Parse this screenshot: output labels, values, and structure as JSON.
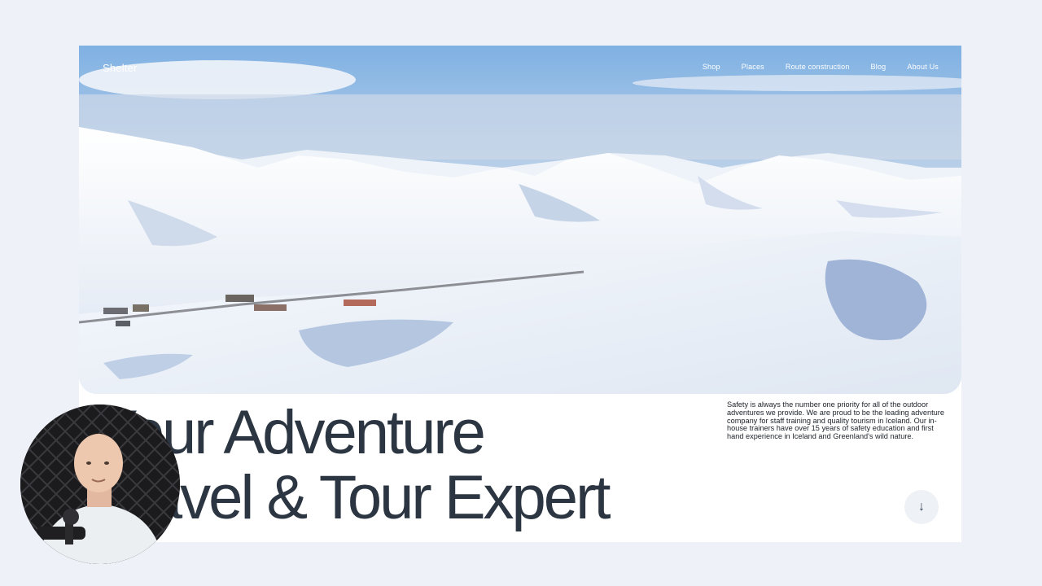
{
  "site": {
    "logo": "Shelter",
    "nav": [
      "Shop",
      "Places",
      "Route construction",
      "Blog",
      "About Us"
    ]
  },
  "hero": {
    "headline_line1": "Your Adventure",
    "headline_line2": "Travel & Tour Expert",
    "description": "Safety is always the number one priority for all of the outdoor adventures we provide. We are proud to be the leading adventure company for staff training and quality tourism in Iceland. Our in-house trainers have over 15 years of safety education and first hand experience in Iceland and Greenland's wild nature.",
    "scroll_icon": "arrow-down-icon"
  },
  "overlay": {
    "webcam_icon": "presenter-webcam"
  }
}
